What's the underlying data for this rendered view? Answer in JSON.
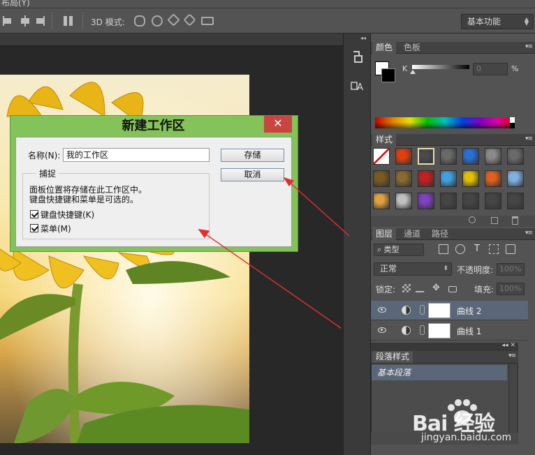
{
  "menubar": {
    "partial_text": "布局(Y)"
  },
  "options_bar": {
    "mode3d_label": "3D 模式:",
    "workspace": "基本功能"
  },
  "color_panel": {
    "tabs": [
      "颜色",
      "色板"
    ],
    "channel_label": "K",
    "value": "0",
    "unit": "%",
    "foreground": "#ffffff",
    "background": "#000000"
  },
  "styles_panel": {
    "tab": "样式",
    "swatches": [
      "none",
      "#e04010",
      "#4a4a4a",
      "#6a6a6a",
      "#2a6fd6",
      "#8a8a8a",
      "#6a6a6a",
      "#7a5a20",
      "#8a6a30",
      "#c02020",
      "#40a0e0",
      "#e0c000",
      "#e06020",
      "#80b0e0",
      "#e0a040",
      "#c0c0c0",
      "#8040c0",
      "#454545",
      "#454545",
      "#454545",
      "#454545"
    ]
  },
  "layers_panel": {
    "tabs": [
      "图层",
      "通道",
      "路径"
    ],
    "filter_kind": "类型",
    "blend_mode": "正常",
    "opacity_label": "不透明度:",
    "opacity_value": "100%",
    "lock_label": "锁定:",
    "fill_label": "填充:",
    "fill_value": "100%",
    "layers": [
      {
        "name": "曲线 2",
        "selected": true
      },
      {
        "name": "曲线 1",
        "selected": false
      }
    ]
  },
  "paragraph_styles_panel": {
    "tab": "段落样式",
    "items": [
      "基本段落"
    ]
  },
  "dialog": {
    "title": "新建工作区",
    "close": "✕",
    "name_label": "名称(N):",
    "name_value": "我的工作区",
    "save_button": "存储",
    "cancel_button": "取消",
    "capture_legend": "捕捉",
    "capture_desc_1": "面板位置将存储在此工作区中。",
    "capture_desc_2": "键盘快捷键和菜单是可选的。",
    "checkbox_shortcuts": {
      "label": "键盘快捷键(K)",
      "checked": true
    },
    "checkbox_menus": {
      "label": "菜单(M)",
      "checked": true
    }
  },
  "watermark": {
    "brand": "Bai 经验",
    "url": "jingyan.baidu.com"
  }
}
